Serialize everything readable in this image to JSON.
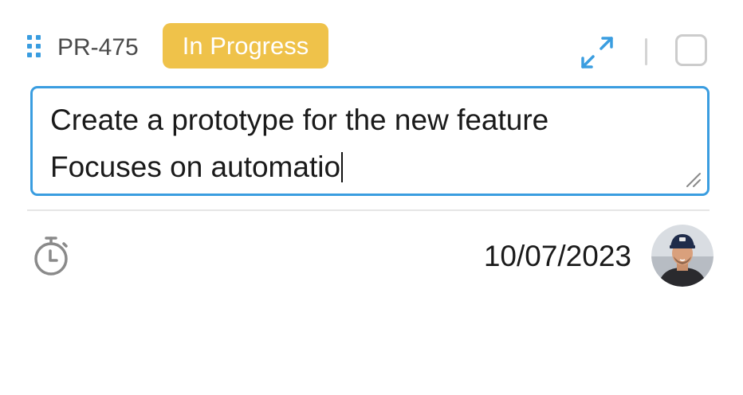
{
  "ticket": {
    "id": "PR-475",
    "status": "In Progress",
    "status_color": "#efc24a",
    "description_lines": [
      "Create a prototype for the new feature",
      "Focuses on automatio"
    ],
    "due_date": "10/07/2023",
    "completed": false
  },
  "icons": {
    "drag": "drag-handle-icon",
    "expand": "expand-icon",
    "timer": "stopwatch-icon",
    "resize": "resize-grip-icon"
  },
  "colors": {
    "accent": "#3a9de0",
    "badge": "#efc24a",
    "muted": "#8a8a8a"
  }
}
